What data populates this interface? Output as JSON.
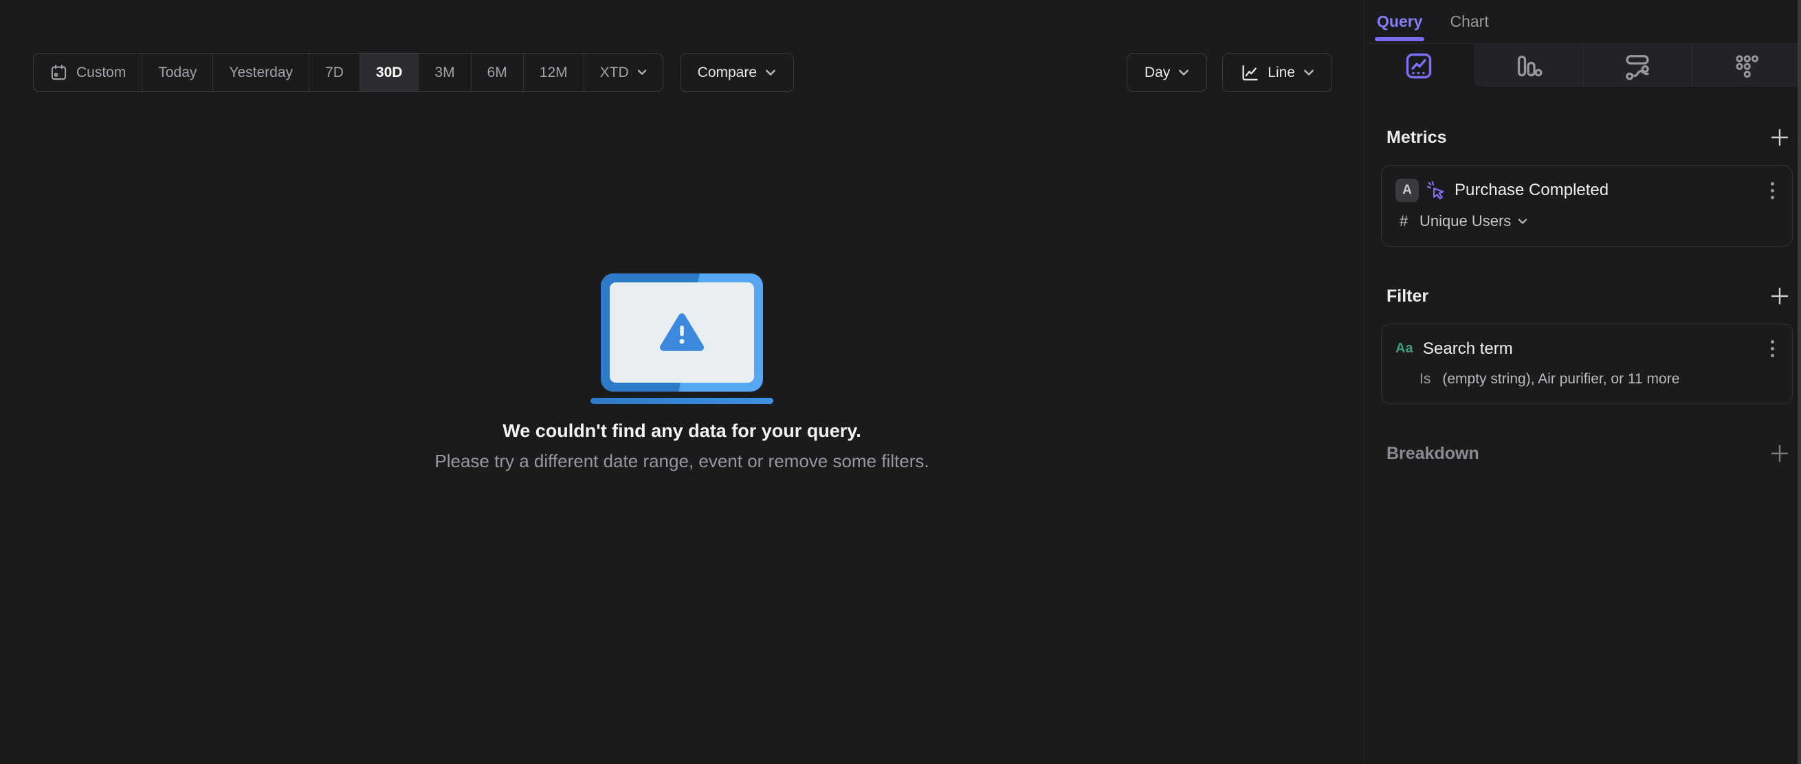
{
  "colors": {
    "background": "#1b1b1d",
    "accent_purple": "#776af1",
    "accent_blue": "#3d89de",
    "green_property": "#3f9e78",
    "selected_segment_bg": "#2d2d31"
  },
  "toolbar": {
    "date_ranges": [
      "Custom",
      "Today",
      "Yesterday",
      "7D",
      "30D",
      "3M",
      "6M",
      "12M",
      "XTD"
    ],
    "selected_range": "30D",
    "compare_label": "Compare",
    "interval_label": "Day",
    "chart_type_label": "Line"
  },
  "empty_state": {
    "title": "We couldn't find any data for your query.",
    "subtitle": "Please try a different date range, event or remove some filters."
  },
  "panel": {
    "tabs": [
      {
        "label": "Query",
        "active": true
      },
      {
        "label": "Chart",
        "active": false
      }
    ],
    "view_tabs": [
      "insights-line",
      "bar",
      "flows",
      "retention"
    ],
    "active_view_tab": "insights-line",
    "metrics": {
      "header": "Metrics",
      "items": [
        {
          "badge": "A",
          "name": "Purchase Completed",
          "aggregation_symbol": "#",
          "aggregation": "Unique Users"
        }
      ]
    },
    "filter": {
      "header": "Filter",
      "items": [
        {
          "type_icon": "Aa",
          "property": "Search term",
          "operator": "Is",
          "value": "(empty string), Air purifier, or 11 more"
        }
      ]
    },
    "breakdown": {
      "header": "Breakdown"
    }
  }
}
